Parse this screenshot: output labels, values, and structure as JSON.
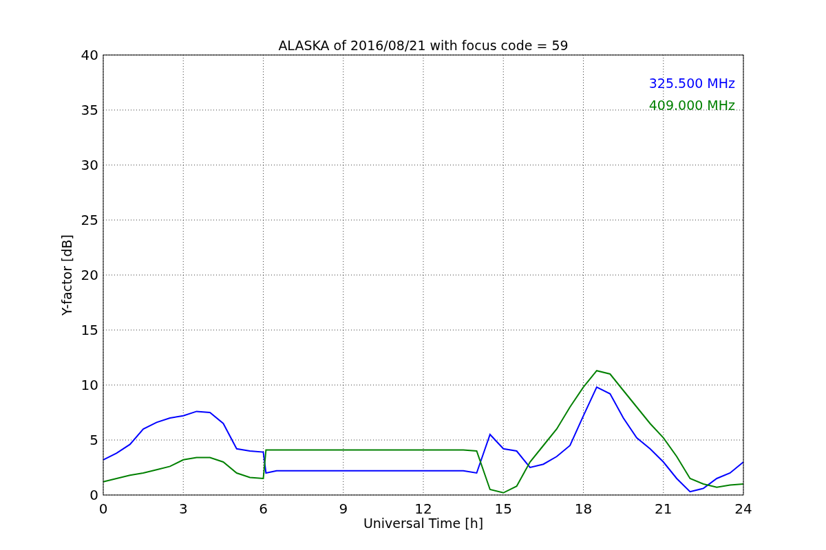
{
  "chart": {
    "chart_data": {
      "type": "line",
      "title": "ALASKA of 2016/08/21 with focus code = 59",
      "xlabel": "Universal Time [h]",
      "ylabel": "Y-factor [dB]",
      "x": [
        0,
        0.5,
        1,
        1.5,
        2,
        2.5,
        3,
        3.5,
        4,
        4.5,
        5,
        5.5,
        6,
        6.1,
        6.5,
        13.5,
        14,
        14.5,
        15,
        15.5,
        16,
        16.5,
        17,
        17.5,
        18,
        18.5,
        19,
        19.5,
        20,
        20.5,
        21,
        21.5,
        22,
        22.5,
        23,
        23.5,
        24
      ],
      "series": [
        {
          "name": "325.500 MHz",
          "color": "#0000ff",
          "values": [
            3.2,
            3.8,
            4.6,
            6.0,
            6.6,
            7.0,
            7.2,
            7.6,
            7.5,
            6.5,
            4.2,
            4.0,
            3.9,
            2.0,
            2.2,
            2.2,
            2.0,
            5.5,
            4.2,
            4.0,
            2.5,
            2.8,
            3.5,
            4.5,
            7.2,
            9.8,
            9.2,
            7.0,
            5.2,
            4.2,
            3.0,
            1.5,
            0.3,
            0.6,
            1.5,
            2.0,
            3.0
          ]
        },
        {
          "name": "409.000 MHz",
          "color": "#008000",
          "values": [
            1.2,
            1.5,
            1.8,
            2.0,
            2.3,
            2.6,
            3.2,
            3.4,
            3.4,
            3.0,
            2.0,
            1.6,
            1.5,
            4.1,
            4.1,
            4.1,
            4.0,
            0.5,
            0.2,
            0.8,
            3.0,
            4.5,
            6.0,
            8.0,
            9.8,
            11.3,
            11.0,
            9.5,
            8.0,
            6.5,
            5.2,
            3.5,
            1.5,
            1.0,
            0.7,
            0.9,
            1.0
          ]
        }
      ],
      "xlim": [
        0,
        24
      ],
      "ylim": [
        0,
        40
      ],
      "xticks": [
        0,
        3,
        6,
        9,
        12,
        15,
        18,
        21,
        24
      ],
      "yticks": [
        0,
        5,
        10,
        15,
        20,
        25,
        30,
        35,
        40
      ],
      "grid": true
    }
  }
}
